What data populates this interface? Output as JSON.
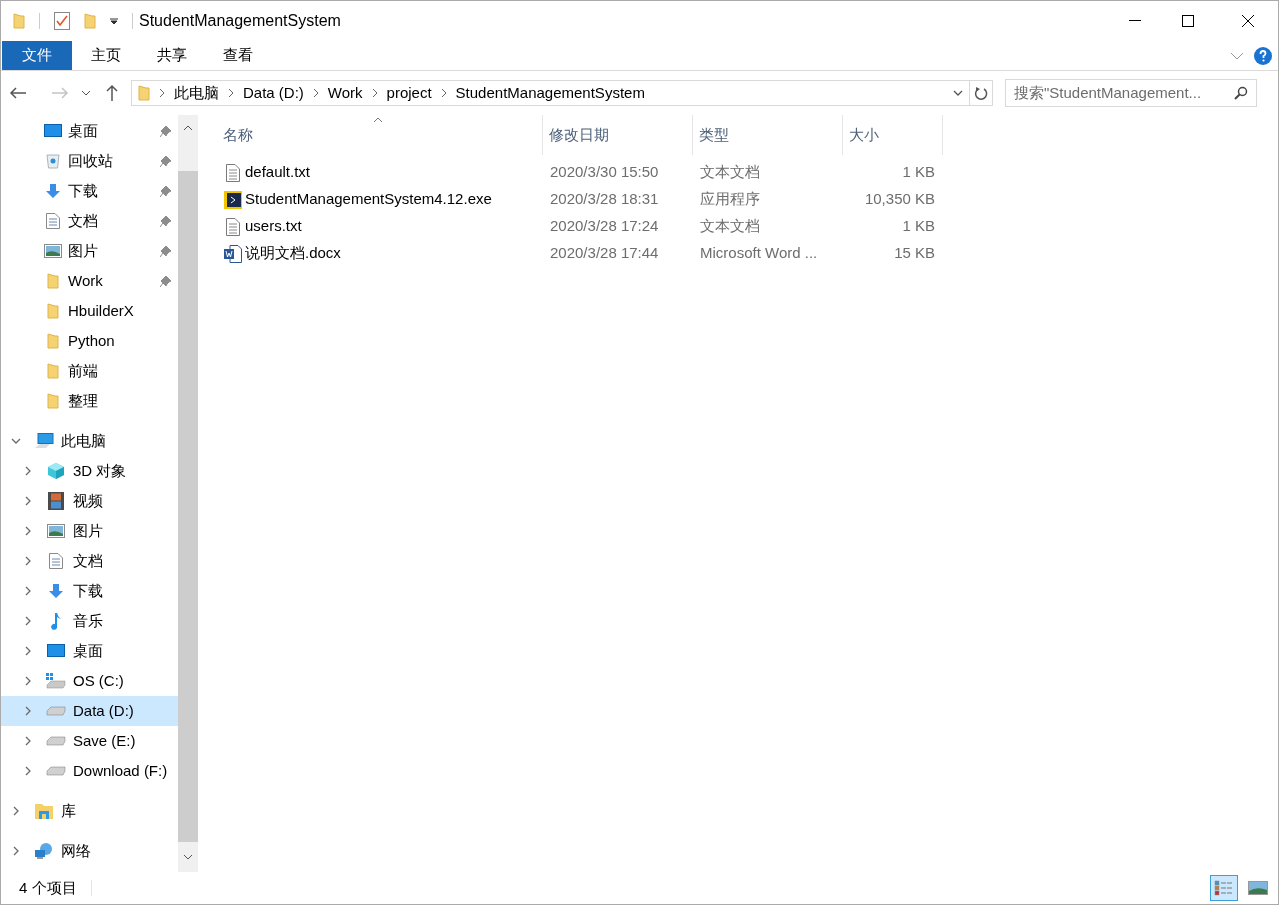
{
  "window": {
    "title": "StudentManagementSystem"
  },
  "ribbon_tabs": [
    {
      "label": "文件",
      "selected": true
    },
    {
      "label": "主页",
      "selected": false
    },
    {
      "label": "共享",
      "selected": false
    },
    {
      "label": "查看",
      "selected": false
    }
  ],
  "address_bar": {
    "segments": [
      "此电脑",
      "Data (D:)",
      "Work",
      "project",
      "StudentManagementSystem"
    ]
  },
  "search": {
    "placeholder": "搜索\"StudentManagement..."
  },
  "quick_access": [
    {
      "label": "桌面",
      "kind": "desktop",
      "pinned": true
    },
    {
      "label": "回收站",
      "kind": "recycle",
      "pinned": true
    },
    {
      "label": "下载",
      "kind": "download",
      "pinned": true
    },
    {
      "label": "文档",
      "kind": "document",
      "pinned": true
    },
    {
      "label": "图片",
      "kind": "picture",
      "pinned": true
    },
    {
      "label": "Work",
      "kind": "folder",
      "pinned": true
    },
    {
      "label": "HbuilderX",
      "kind": "folder",
      "pinned": false
    },
    {
      "label": "Python",
      "kind": "folder",
      "pinned": false
    },
    {
      "label": "前端",
      "kind": "folder",
      "pinned": false
    },
    {
      "label": "整理",
      "kind": "folder",
      "pinned": false
    }
  ],
  "tree": [
    {
      "label": "此电脑",
      "kind": "pc",
      "expanded": true,
      "selected": false,
      "children": [
        {
          "label": "3D 对象",
          "kind": "cube",
          "expanded": false,
          "selected": false
        },
        {
          "label": "视频",
          "kind": "video",
          "expanded": false,
          "selected": false
        },
        {
          "label": "图片",
          "kind": "picture",
          "expanded": false,
          "selected": false
        },
        {
          "label": "文档",
          "kind": "document",
          "expanded": false,
          "selected": false
        },
        {
          "label": "下载",
          "kind": "download",
          "expanded": false,
          "selected": false
        },
        {
          "label": "音乐",
          "kind": "music",
          "expanded": false,
          "selected": false
        },
        {
          "label": "桌面",
          "kind": "desktop",
          "expanded": false,
          "selected": false
        },
        {
          "label": "OS (C:)",
          "kind": "windrive",
          "expanded": false,
          "selected": false
        },
        {
          "label": "Data (D:)",
          "kind": "drive",
          "expanded": false,
          "selected": true
        },
        {
          "label": "Save (E:)",
          "kind": "drive",
          "expanded": false,
          "selected": false
        },
        {
          "label": "Download (F:)",
          "kind": "drive",
          "expanded": false,
          "selected": false
        }
      ]
    },
    {
      "label": "库",
      "kind": "library",
      "expanded": false,
      "selected": false
    },
    {
      "label": "网络",
      "kind": "network",
      "expanded": false,
      "selected": false
    }
  ],
  "table": {
    "columns": [
      "名称",
      "修改日期",
      "类型",
      "大小"
    ],
    "rows": [
      {
        "kind": "text",
        "name": "default.txt",
        "date": "2020/3/30 15:50",
        "type": "文本文档",
        "size": "1 KB"
      },
      {
        "kind": "exe",
        "name": "StudentManagementSystem4.12.exe",
        "date": "2020/3/28 18:31",
        "type": "应用程序",
        "size": "10,350 KB"
      },
      {
        "kind": "text",
        "name": "users.txt",
        "date": "2020/3/28 17:24",
        "type": "文本文档",
        "size": "1 KB"
      },
      {
        "kind": "word",
        "name": "说明文档.docx",
        "date": "2020/3/28 17:44",
        "type": "Microsoft Word ...",
        "size": "15 KB"
      }
    ]
  },
  "status_bar": {
    "count": "4 个项目",
    "views": [
      {
        "kind": "details",
        "selected": true
      },
      {
        "kind": "thumbnails",
        "selected": false
      }
    ]
  }
}
